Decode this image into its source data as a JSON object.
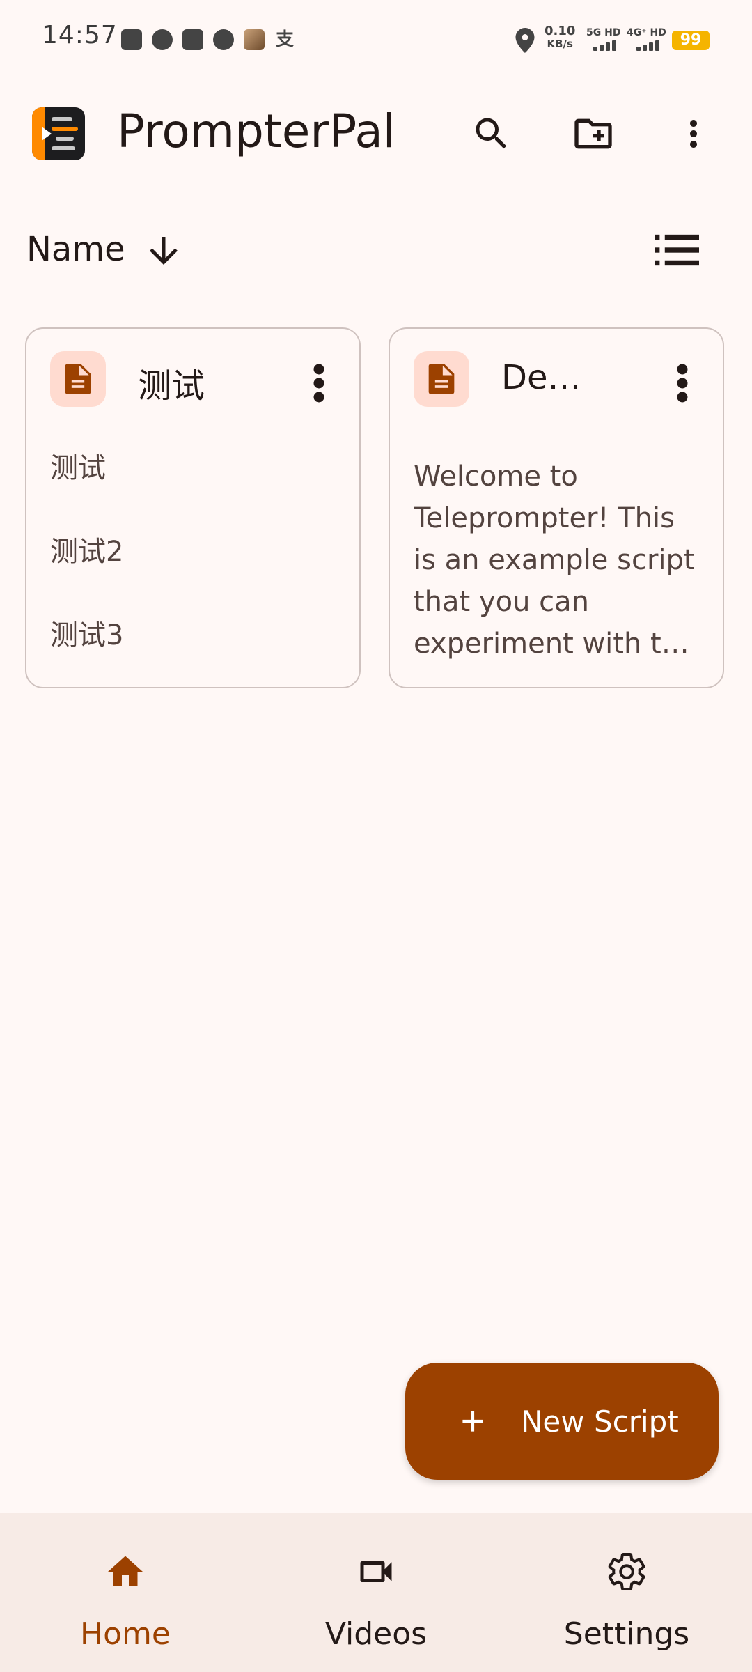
{
  "status_bar": {
    "time": "14:57",
    "net_speed_value": "0.10",
    "net_speed_unit": "KB/s",
    "sim1": "5G HD",
    "sim2": "4G⁺ HD",
    "battery": "99",
    "app_icons": [
      "toutiao-icon",
      "chat-bubble-icon",
      "wallet-icon",
      "dollar-icon",
      "photo-icon",
      "alipay-icon"
    ],
    "alipay_glyph": "支"
  },
  "app_bar": {
    "title": "PrompterPal",
    "actions": [
      "search-icon",
      "new-folder-icon",
      "more-vert-icon"
    ]
  },
  "sort": {
    "label": "Name",
    "direction_icon": "arrow-down-icon",
    "view_icon": "list-view-icon"
  },
  "scripts": [
    {
      "name": "测试",
      "lines": [
        "测试",
        "测试2",
        "测试3"
      ]
    },
    {
      "name": "De…",
      "lines": [
        "Welcome to",
        "Teleprompter! This",
        "is an example script",
        "that you can",
        "experiment with t…"
      ]
    }
  ],
  "fab": {
    "label": "New Script",
    "icon": "plus-icon"
  },
  "bottom_nav": {
    "items": [
      {
        "label": "Home",
        "icon": "home-icon",
        "active": true
      },
      {
        "label": "Videos",
        "icon": "video-camera-icon",
        "active": false
      },
      {
        "label": "Settings",
        "icon": "gear-icon",
        "active": false
      }
    ]
  },
  "colors": {
    "background": "#fff8f6",
    "primary": "#9c4100",
    "on_surface": "#231917",
    "chip": "#ffdbd0",
    "nav_bg": "#f7ebe6"
  }
}
